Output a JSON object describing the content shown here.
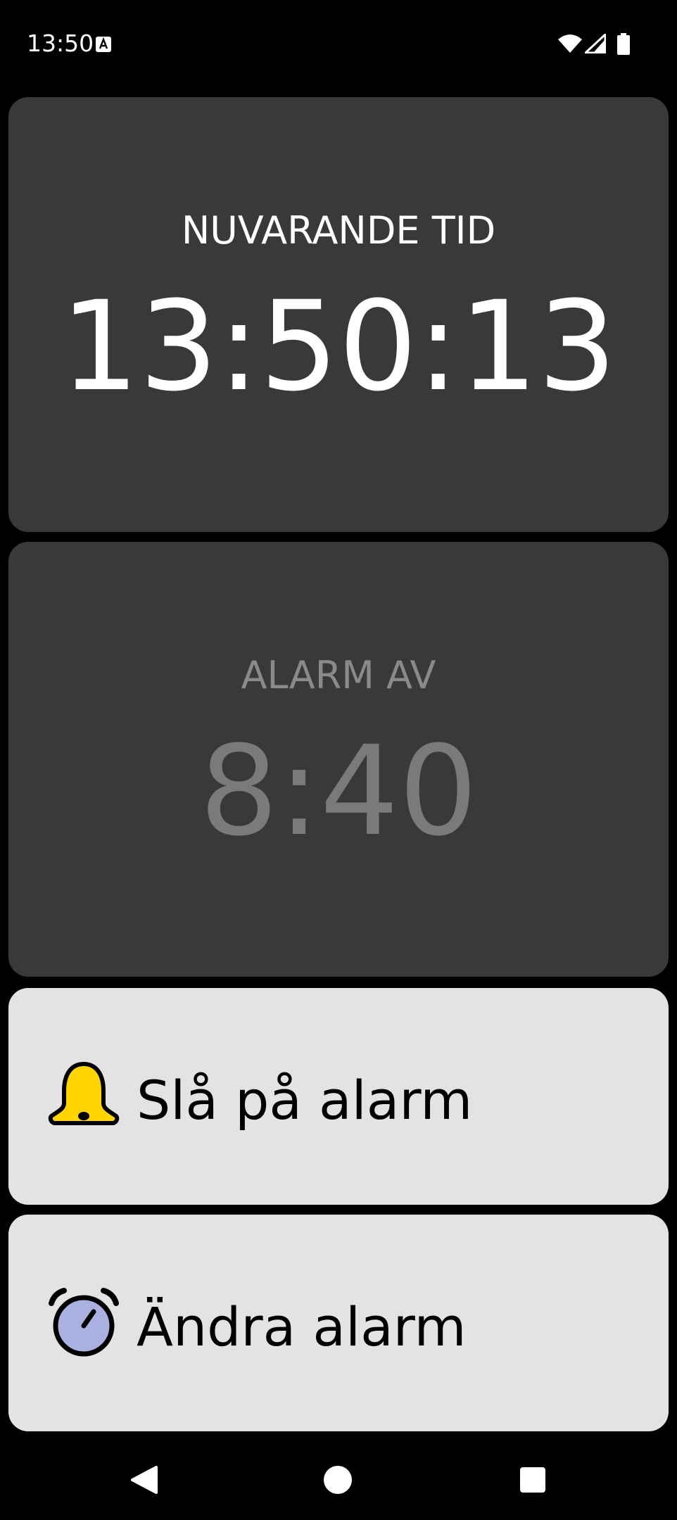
{
  "status_bar": {
    "time": "13:50",
    "icons": [
      "a-notification-icon",
      "wifi-icon",
      "signal-icon",
      "battery-icon"
    ]
  },
  "current_time_card": {
    "title": "NUVARANDE TID",
    "value": "13:50:13"
  },
  "alarm_card": {
    "title": "ALARM AV",
    "value": "8:40"
  },
  "buttons": {
    "alarm_on": {
      "label": "Slå på alarm",
      "icon": "bell-icon"
    },
    "change_alarm": {
      "label": "Ändra alarm",
      "icon": "alarm-clock-icon"
    }
  },
  "navigation": {
    "items": [
      "back-icon",
      "home-icon",
      "recents-icon"
    ]
  },
  "colors": {
    "background": "#000000",
    "card_dark": "#393939",
    "card_light": "#e3e3e3",
    "alarm_off_text": "#7a7a7a",
    "bell": "#ffd400",
    "clock_face": "#aab0e0"
  }
}
